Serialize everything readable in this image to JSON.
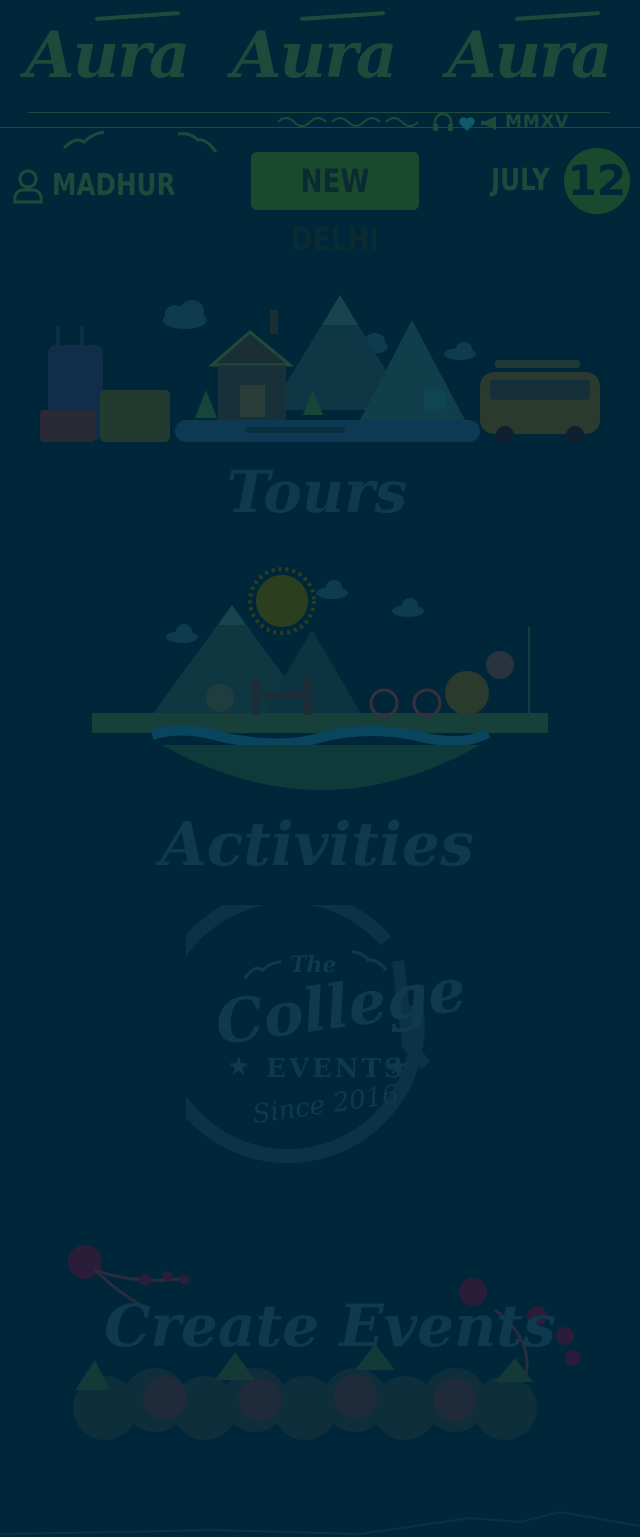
{
  "header": {
    "brand": [
      "Aura",
      "Aura",
      "Aura"
    ],
    "tagline": "MMXV"
  },
  "bar": {
    "user_name": "MADHUR",
    "city": "NEW DELHI",
    "month": "JULY",
    "day": "12"
  },
  "cards": {
    "tours": "Tours",
    "activities": "Activities",
    "college_the": "The",
    "college": "College",
    "events_word": "EVENTS",
    "since": "Since 2016",
    "create": "Create Events"
  },
  "colors": {
    "background": "#00263a",
    "accent": "#1d4a3a",
    "muted": "#0f3a4e"
  }
}
